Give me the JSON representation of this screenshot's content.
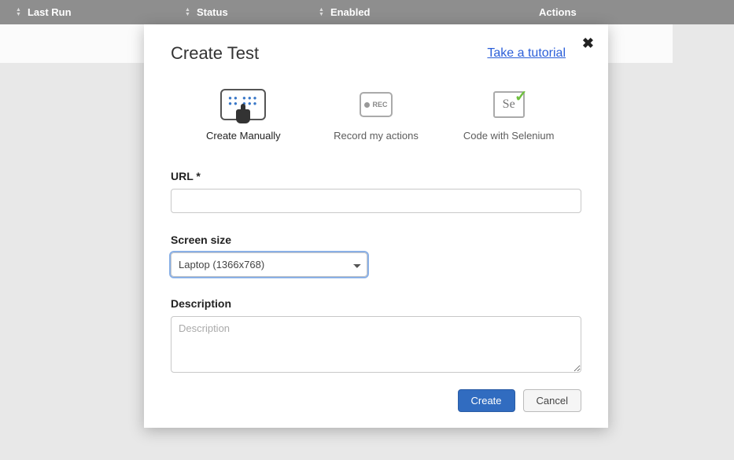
{
  "background": {
    "columns": [
      "Last Run",
      "Status",
      "Enabled",
      "Actions"
    ]
  },
  "modal": {
    "title": "Create Test",
    "tutorial_link": "Take a tutorial",
    "options": {
      "manual": "Create Manually",
      "record": "Record my actions",
      "selenium": "Code with Selenium",
      "rec_badge": "REC",
      "sel_badge": "Se"
    },
    "form": {
      "url_label": "URL *",
      "url_value": "",
      "screen_label": "Screen size",
      "screen_selected": "Laptop (1366x768)",
      "desc_label": "Description",
      "desc_placeholder": "Description",
      "desc_value": ""
    },
    "buttons": {
      "create": "Create",
      "cancel": "Cancel"
    }
  }
}
